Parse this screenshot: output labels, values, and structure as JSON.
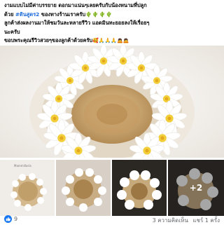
{
  "post": {
    "line1": "งามแบบไม่มีค่าบรรยาย ดอกมาแน่นๆเลยครับกับน้องหนามที่ปลูก",
    "line2_prefix": "ด้วย ",
    "hashtag": "#ดินสูตร2",
    "line2_suffix": " ของทางร้านเราครับ",
    "line2_emoji": "🌵🌵🌵🌵",
    "line3": "ลูกค้าส่งผลงานมาให้ชมวันละหลายรีวิว แอดมินทะยอยลงให้เรื่อยๆ",
    "line4": "นะครับ",
    "line5": "ขอบพระคุณรีวิวสวยๆของลูกค้าด้วยครับ",
    "line5_emoji": "🥰🙏🙏🙏🙇🙇"
  },
  "thumb1": {
    "caption": "Mammillaria"
  },
  "gallery": {
    "more_label": "+2"
  },
  "reactions": {
    "count": "9"
  },
  "stats": {
    "comments": "3 ความคิดเห็น",
    "shares": "แชร์ 1 ครั้ง"
  },
  "colors": {
    "hashtag": "#216fdb",
    "like": "#1877f2",
    "meta": "#65676b"
  },
  "icons": {
    "like": "thumbs-up-icon"
  }
}
